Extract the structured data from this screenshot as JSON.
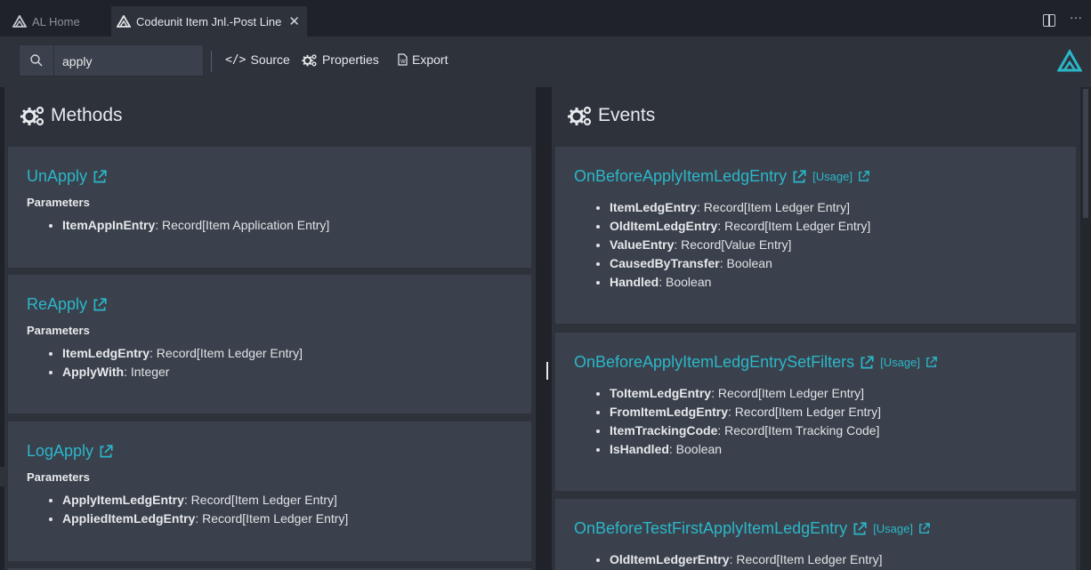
{
  "tabs": [
    {
      "label": "AL Home"
    },
    {
      "label": "Codeunit Item Jnl.-Post Line"
    }
  ],
  "toolbar": {
    "search_value": "apply",
    "source_label": "Source",
    "properties_label": "Properties",
    "export_label": "Export"
  },
  "methods": {
    "title": "Methods",
    "items": [
      {
        "name": "UnApply",
        "params_label": "Parameters",
        "params": [
          {
            "name": "ItemAppInEntry",
            "type": ": Record[Item Application Entry]"
          }
        ]
      },
      {
        "name": "ReApply",
        "params_label": "Parameters",
        "params": [
          {
            "name": "ItemLedgEntry",
            "type": ": Record[Item Ledger Entry]"
          },
          {
            "name": "ApplyWith",
            "type": ": Integer"
          }
        ]
      },
      {
        "name": "LogApply",
        "params_label": "Parameters",
        "params": [
          {
            "name": "ApplyItemLedgEntry",
            "type": ": Record[Item Ledger Entry]"
          },
          {
            "name": "AppliedItemLedgEntry",
            "type": ": Record[Item Ledger Entry]"
          }
        ]
      }
    ]
  },
  "events": {
    "title": "Events",
    "usage_label": "[Usage]",
    "items": [
      {
        "name": "OnBeforeApplyItemLedgEntry",
        "params": [
          {
            "name": "ItemLedgEntry",
            "type": ": Record[Item Ledger Entry]"
          },
          {
            "name": "OldItemLedgEntry",
            "type": ": Record[Item Ledger Entry]"
          },
          {
            "name": "ValueEntry",
            "type": ": Record[Value Entry]"
          },
          {
            "name": "CausedByTransfer",
            "type": ": Boolean"
          },
          {
            "name": "Handled",
            "type": ": Boolean"
          }
        ]
      },
      {
        "name": "OnBeforeApplyItemLedgEntrySetFilters",
        "params": [
          {
            "name": "ToItemLedgEntry",
            "type": ": Record[Item Ledger Entry]"
          },
          {
            "name": "FromItemLedgEntry",
            "type": ": Record[Item Ledger Entry]"
          },
          {
            "name": "ItemTrackingCode",
            "type": ": Record[Item Tracking Code]"
          },
          {
            "name": "IsHandled",
            "type": ": Boolean"
          }
        ]
      },
      {
        "name": "OnBeforeTestFirstApplyItemLedgEntry",
        "params": [
          {
            "name": "OldItemLedgerEntry",
            "type": ": Record[Item Ledger Entry]"
          }
        ]
      }
    ]
  },
  "colors": {
    "accent": "#2ab7c9",
    "panel": "#2d323b",
    "card": "#3b414c",
    "background": "#1f2329"
  }
}
